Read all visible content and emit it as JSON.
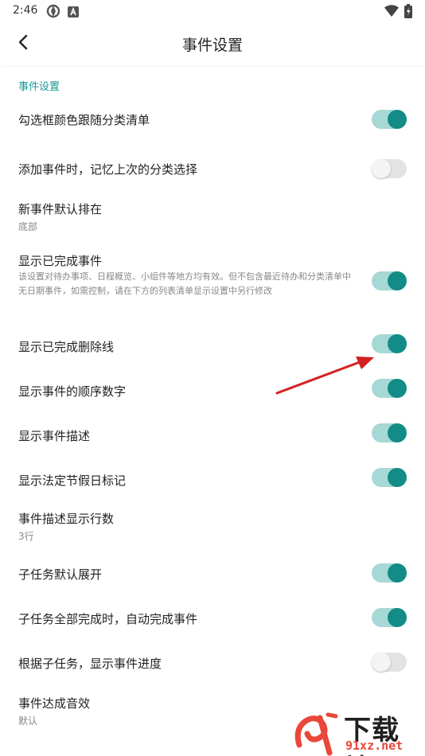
{
  "status_bar": {
    "time": "2:46"
  },
  "header": {
    "title": "事件设置",
    "back_icon": "chevron-left-icon"
  },
  "section": {
    "title": "事件设置"
  },
  "settings": [
    {
      "label": "勾选框颜色跟随分类清单",
      "toggle": true
    },
    {
      "label": "添加事件时，记忆上次的分类选择",
      "toggle": false
    },
    {
      "label": "新事件默认排在",
      "value": "底部"
    },
    {
      "label": "显示已完成事件",
      "description": "该设置对待办事项、日程概览、小组件等地方均有效。但不包含最近待办和分类清单中无日期事件，如需控制，请在下方的列表清单显示设置中另行修改",
      "toggle": true
    },
    {
      "label": "显示已完成删除线",
      "toggle": true
    },
    {
      "label": "显示事件的顺序数字",
      "toggle": true
    },
    {
      "label": "显示事件描述",
      "toggle": true
    },
    {
      "label": "显示法定节假日标记",
      "toggle": true
    },
    {
      "label": "事件描述显示行数",
      "value": "3行"
    },
    {
      "label": "子任务默认展开",
      "toggle": true
    },
    {
      "label": "子任务全部完成时，自动完成事件",
      "toggle": true
    },
    {
      "label": "根据子任务，显示事件进度",
      "toggle": false
    },
    {
      "label": "事件达成音效",
      "value": "默认"
    }
  ],
  "watermark": {
    "text": "下载站",
    "url": "91xz.net"
  },
  "colors": {
    "accent": "#138b86",
    "accent_track": "#a6d8d5",
    "section": "#1a9a94",
    "arrow": "#d42020"
  }
}
